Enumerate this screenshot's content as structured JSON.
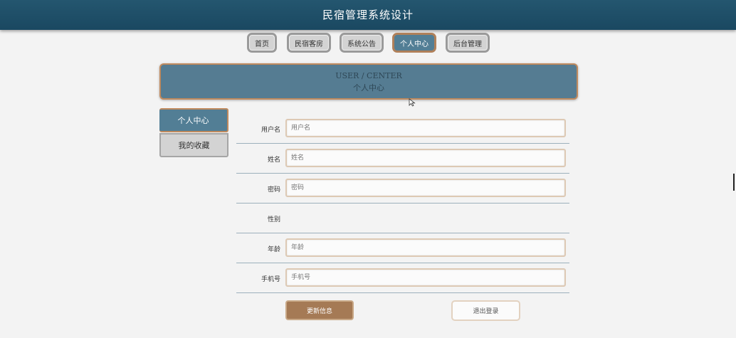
{
  "app": {
    "title": "民宿管理系统设计"
  },
  "nav": {
    "items": [
      {
        "label": "首页"
      },
      {
        "label": "民宿客房"
      },
      {
        "label": "系统公告"
      },
      {
        "label": "个人中心",
        "active": true
      },
      {
        "label": "后台管理"
      }
    ]
  },
  "banner": {
    "en": "USER / CENTER",
    "cn": "个人中心"
  },
  "sidebar": {
    "items": [
      {
        "label": "个人中心",
        "active": true
      },
      {
        "label": "我的收藏",
        "active": false
      }
    ]
  },
  "form": {
    "fields": [
      {
        "label": "用户名",
        "placeholder": "用户名",
        "value": ""
      },
      {
        "label": "姓名",
        "placeholder": "姓名",
        "value": ""
      },
      {
        "label": "密码",
        "placeholder": "密码",
        "value": ""
      },
      {
        "label": "性别"
      },
      {
        "label": "年龄",
        "placeholder": "年龄",
        "value": ""
      },
      {
        "label": "手机号",
        "placeholder": "手机号",
        "value": ""
      }
    ],
    "update_label": "更新信息",
    "logout_label": "退出登录"
  },
  "colors": {
    "header": "#1f4f68",
    "accent": "#527e95",
    "brown": "#a57a55",
    "border_tan": "#c08a5e"
  }
}
